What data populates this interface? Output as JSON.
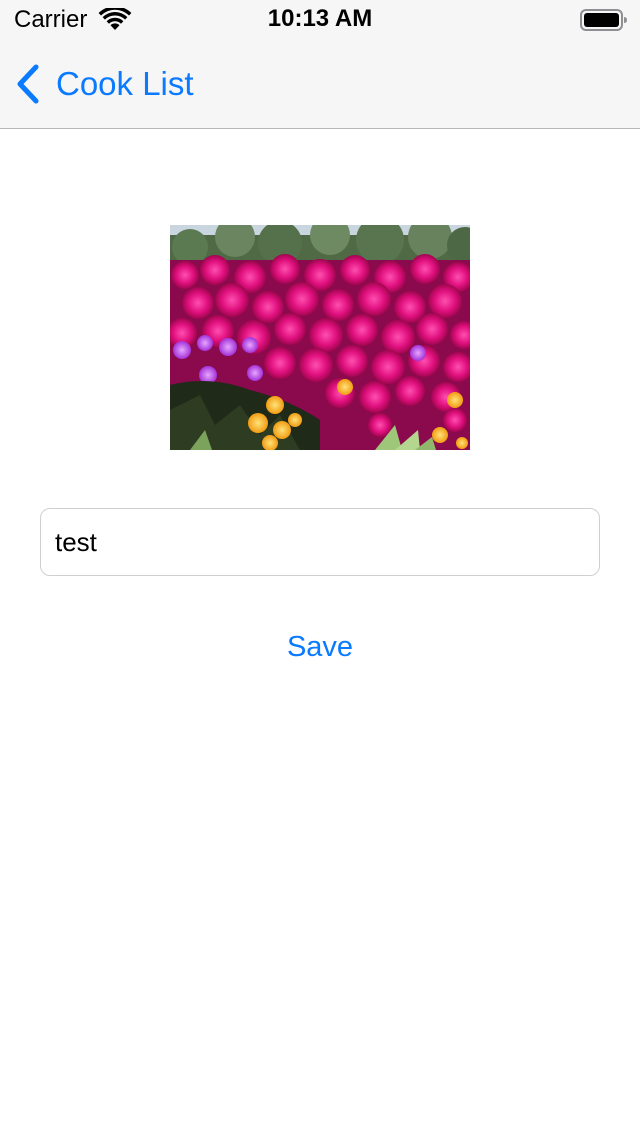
{
  "status_bar": {
    "carrier": "Carrier",
    "time": "10:13 AM",
    "wifi_icon": "wifi-icon",
    "battery_icon": "battery-icon"
  },
  "nav": {
    "back_label": "Cook List",
    "back_icon": "chevron-left-icon"
  },
  "form": {
    "name_value": "test",
    "save_label": "Save"
  },
  "colors": {
    "accent": "#0a7aff",
    "bar_background": "#f6f6f6",
    "field_border": "#cfcfd3"
  }
}
